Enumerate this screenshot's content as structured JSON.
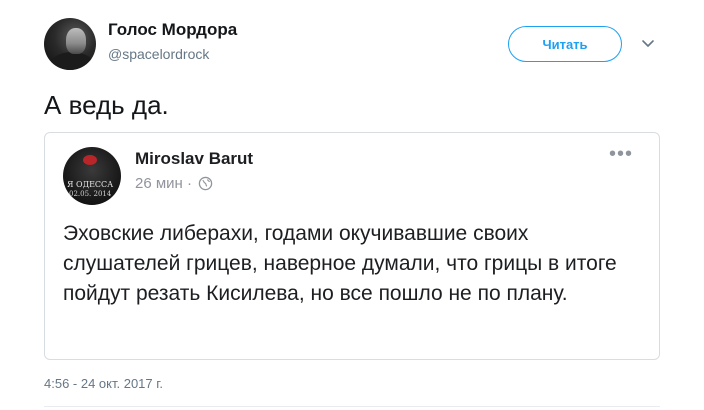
{
  "tweet": {
    "author_name": "Голос Мордора",
    "author_handle": "@spacelordrock",
    "follow_label": "Читать",
    "text": "А ведь да.",
    "timestamp": "4:56 - 24 окт. 2017 г.",
    "caret_icon": "chevron-down-icon",
    "accent_color": "#1da1f2"
  },
  "embedded_post": {
    "author_name": "Miroslav Barut",
    "time": "26 мин ·",
    "privacy_icon": "globe-icon",
    "menu_icon": "more-dots-icon",
    "avatar_caption_line1": "Я ОДЕССА",
    "avatar_caption_line2": "02.05. 2014",
    "text": "Эховские либерахи, годами окучивавшие своих слушателей грицев, наверное думали, что грицы в итоге пойдут резать Кисилева, но все пошло не по плану."
  }
}
